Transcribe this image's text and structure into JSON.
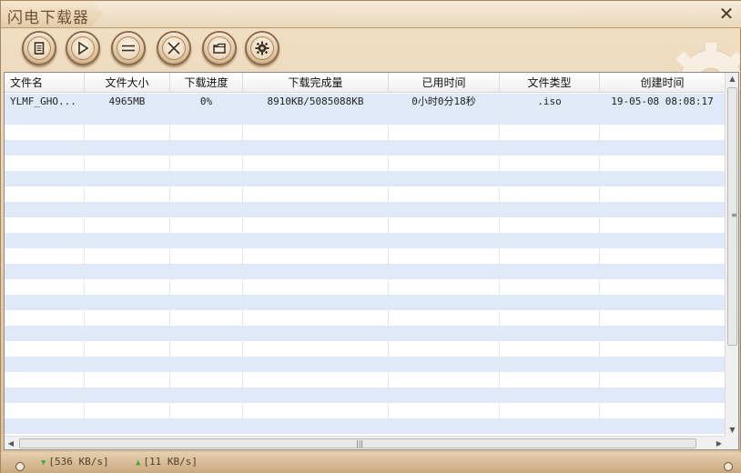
{
  "app": {
    "title": "闪电下载器"
  },
  "toolbar": {
    "buttons": [
      {
        "name": "new-task-button",
        "icon": "document-icon"
      },
      {
        "name": "start-button",
        "icon": "play-icon"
      },
      {
        "name": "pause-button",
        "icon": "pause-icon"
      },
      {
        "name": "delete-button",
        "icon": "close-icon"
      },
      {
        "name": "open-folder-button",
        "icon": "folder-icon"
      },
      {
        "name": "settings-button",
        "icon": "gear-icon"
      }
    ]
  },
  "table": {
    "columns": [
      "文件名",
      "文件大小",
      "下载进度",
      "下载完成量",
      "已用时间",
      "文件类型",
      "创建时间"
    ],
    "rows": [
      [
        "YLMF_GHO...",
        "4965MB",
        "0%",
        "8910KB/5085088KB",
        "0小时0分18秒",
        ".iso",
        "19-05-08  08:08:17"
      ]
    ]
  },
  "status": {
    "download_speed": "[536 KB/s]",
    "upload_speed": "[11 KB/s]"
  },
  "colors": {
    "frame": "#e9d3b3",
    "row_alt": "#dfe9f8",
    "speed_dot": "#3cae3c"
  }
}
